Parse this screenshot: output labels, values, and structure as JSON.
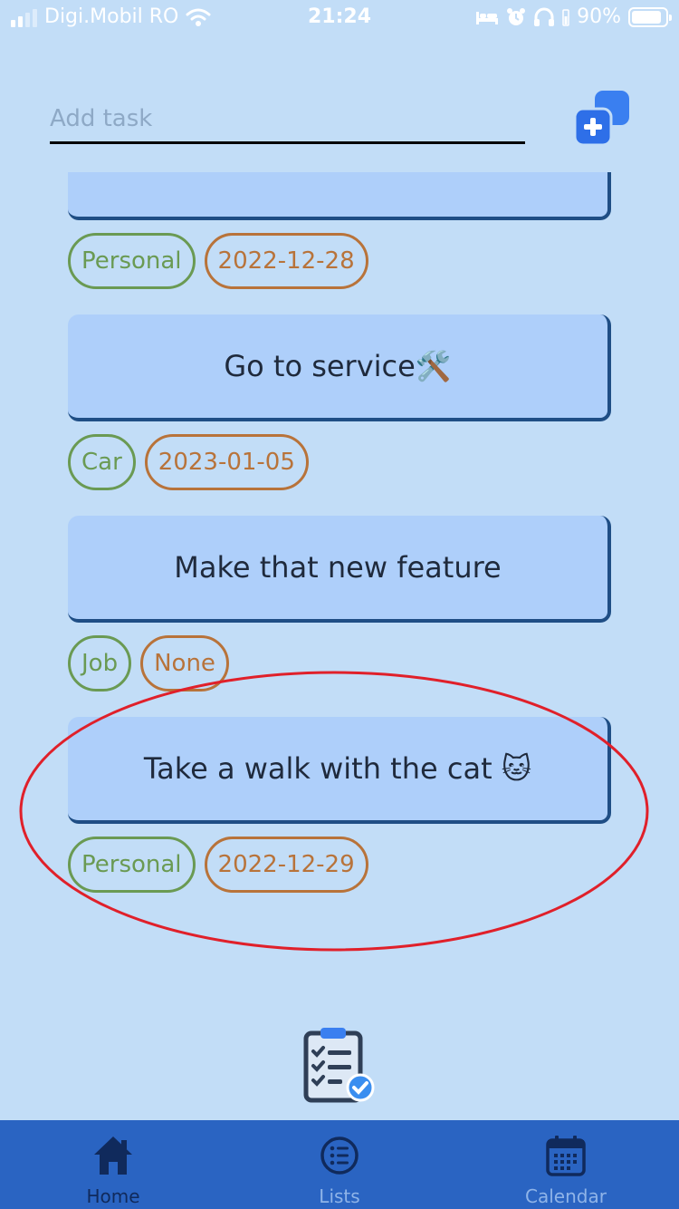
{
  "status_bar": {
    "carrier": "Digi.Mobil RO",
    "time": "21:24",
    "battery_percent": "90%",
    "battery_level": 0.9,
    "icons": [
      "signal-icon",
      "wifi-icon",
      "bed-icon",
      "alarm-icon",
      "headphones-icon",
      "battery-icon"
    ]
  },
  "add_task": {
    "placeholder": "Add task",
    "value": "",
    "button_icon": "add-task-icon"
  },
  "tasks": [
    {
      "title": "",
      "category": "Personal",
      "date": "2022-12-28"
    },
    {
      "title": "Go to service🛠️",
      "category": "Car",
      "date": "2023-01-05"
    },
    {
      "title": "Make that new feature",
      "category": "Job",
      "date": "None"
    },
    {
      "title": "Take a walk with the cat 🐱",
      "category": "Personal",
      "date": "2022-12-29"
    }
  ],
  "annotation": {
    "shape": "ellipse",
    "color": "#e0202a",
    "highlights": "Take a walk with the cat 🐱"
  },
  "center_icon": "clipboard-checklist-icon",
  "nav": {
    "tabs": [
      {
        "label": "Home",
        "icon": "home-icon",
        "active": true
      },
      {
        "label": "Lists",
        "icon": "list-icon",
        "active": false
      },
      {
        "label": "Calendar",
        "icon": "calendar-icon",
        "active": false
      }
    ]
  },
  "colors": {
    "background": "#c2ddf7",
    "card": "#aecffa",
    "card_border": "#1f4e85",
    "category_tag": "#6a9a53",
    "date_tag": "#b8733a",
    "nav_bar": "#2a64c2",
    "nav_active": "#102a5c",
    "nav_inactive": "#8fb4e8"
  }
}
